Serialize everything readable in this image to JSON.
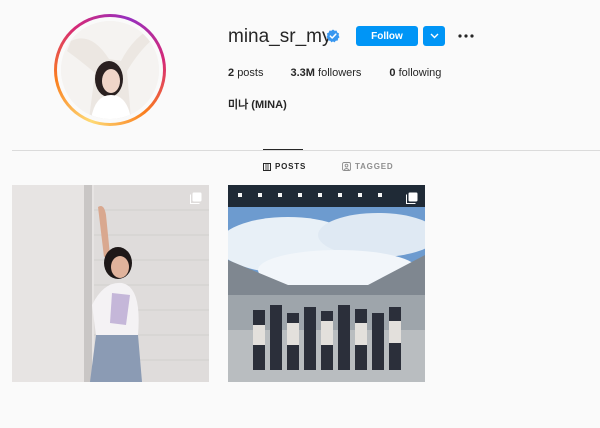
{
  "profile": {
    "username": "mina_sr_my",
    "full_name": "미나 (MINA)",
    "verified": true,
    "avatar_icon": "profile-photo"
  },
  "actions": {
    "follow_label": "Follow",
    "dropdown_icon": "chevron-down-icon",
    "more_icon": "more-options-icon"
  },
  "stats": {
    "posts_count": "2",
    "posts_label": "posts",
    "followers_count": "3.3M",
    "followers_label": "followers",
    "following_count": "0",
    "following_label": "following"
  },
  "tabs": [
    {
      "label": "POSTS",
      "icon": "grid-icon",
      "active": true
    },
    {
      "label": "TAGGED",
      "icon": "tagged-icon",
      "active": false
    }
  ],
  "posts": [
    {
      "icon": "multi-photo-icon"
    },
    {
      "icon": "multi-photo-icon"
    }
  ],
  "colors": {
    "accent": "#0095f6",
    "text": "#262626",
    "muted": "#8e8e8e",
    "background": "#fafafa"
  }
}
